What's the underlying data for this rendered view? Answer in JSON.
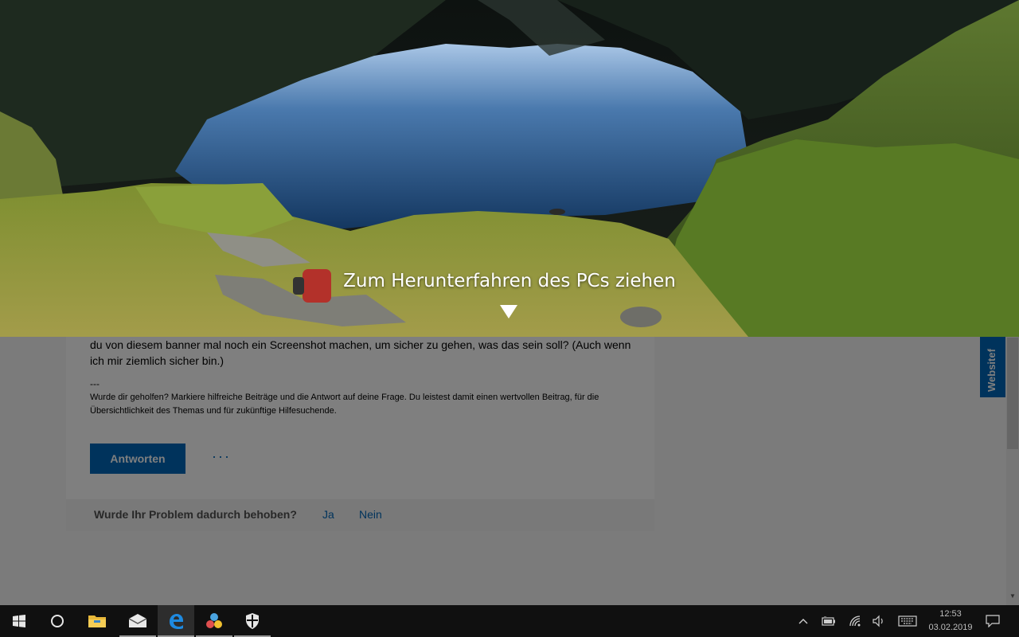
{
  "lockscreen": {
    "message": "Zum Herunterfahren des PCs ziehen",
    "arrow_icon": "down-triangle"
  },
  "post": {
    "body": "du von diesem banner mal noch ein Screenshot machen, um sicher zu gehen, was das sein soll? (Auch wenn ich mir ziemlich sicher bin.)",
    "separator": "---",
    "signature": "Wurde dir geholfen? Markiere hilfreiche Beiträge und die Antwort auf deine Frage. Du leistest damit einen wertvollen Beitrag, für die Übersichtlichkeit des Themas und für zukünftige Hilfesuchende.",
    "reply_label": "Antworten",
    "more_label": "···"
  },
  "feedback": {
    "question": "Wurde Ihr Problem dadurch behoben?",
    "yes": "Ja",
    "no": "Nein"
  },
  "side_tab": {
    "label": "Websitef"
  },
  "taskbar": {
    "apps": [
      {
        "icon": "windows-start-icon"
      },
      {
        "icon": "cortana-circle-icon"
      },
      {
        "icon": "file-explorer-icon"
      },
      {
        "icon": "mail-icon"
      },
      {
        "icon": "edge-browser-icon"
      },
      {
        "icon": "paint-3d-icon"
      },
      {
        "icon": "defender-shield-icon"
      }
    ],
    "tray": {
      "icons": [
        "chevron-up-icon",
        "battery-icon",
        "wifi-icon",
        "volume-icon",
        "keyboard-icon",
        "notification-icon"
      ],
      "time": "12:53",
      "date": "03.02.2019"
    }
  },
  "colors": {
    "accent": "#0067b8",
    "taskbar": "#101010"
  }
}
